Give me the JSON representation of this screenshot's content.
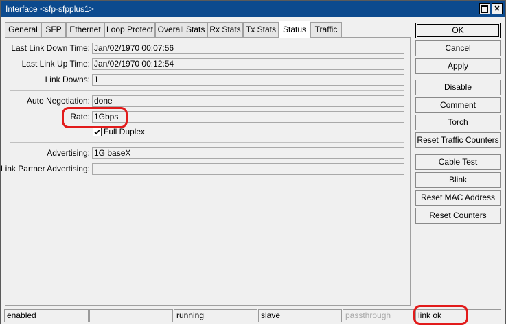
{
  "window": {
    "title": "Interface <sfp-sfpplus1>"
  },
  "tabs": [
    "General",
    "SFP",
    "Ethernet",
    "Loop Protect",
    "Overall Stats",
    "Rx Stats",
    "Tx Stats",
    "Status",
    "Traffic"
  ],
  "active_tab": "Status",
  "fields": {
    "last_link_down_time": {
      "label": "Last Link Down Time:",
      "value": "Jan/02/1970 00:07:56"
    },
    "last_link_up_time": {
      "label": "Last Link Up Time:",
      "value": "Jan/02/1970 00:12:54"
    },
    "link_downs": {
      "label": "Link Downs:",
      "value": "1"
    },
    "auto_negotiation": {
      "label": "Auto Negotiation:",
      "value": "done"
    },
    "rate": {
      "label": "Rate:",
      "value": "1Gbps"
    },
    "full_duplex": {
      "label": "Full Duplex",
      "checked": true
    },
    "advertising": {
      "label": "Advertising:",
      "value": "1G baseX"
    },
    "link_partner_advertising": {
      "label": "Link Partner Advertising:",
      "value": ""
    }
  },
  "buttons": {
    "ok": "OK",
    "cancel": "Cancel",
    "apply": "Apply",
    "disable": "Disable",
    "comment": "Comment",
    "torch": "Torch",
    "reset_traffic_counters": "Reset Traffic Counters",
    "cable_test": "Cable Test",
    "blink": "Blink",
    "reset_mac_address": "Reset MAC Address",
    "reset_counters": "Reset Counters"
  },
  "statusbar": [
    "enabled",
    "",
    "running",
    "slave",
    "passthrough",
    "link ok"
  ],
  "colors": {
    "titlebar": "#0c4a8e",
    "highlight": "#e21b1b",
    "dim_text": "#a8a8a8"
  }
}
